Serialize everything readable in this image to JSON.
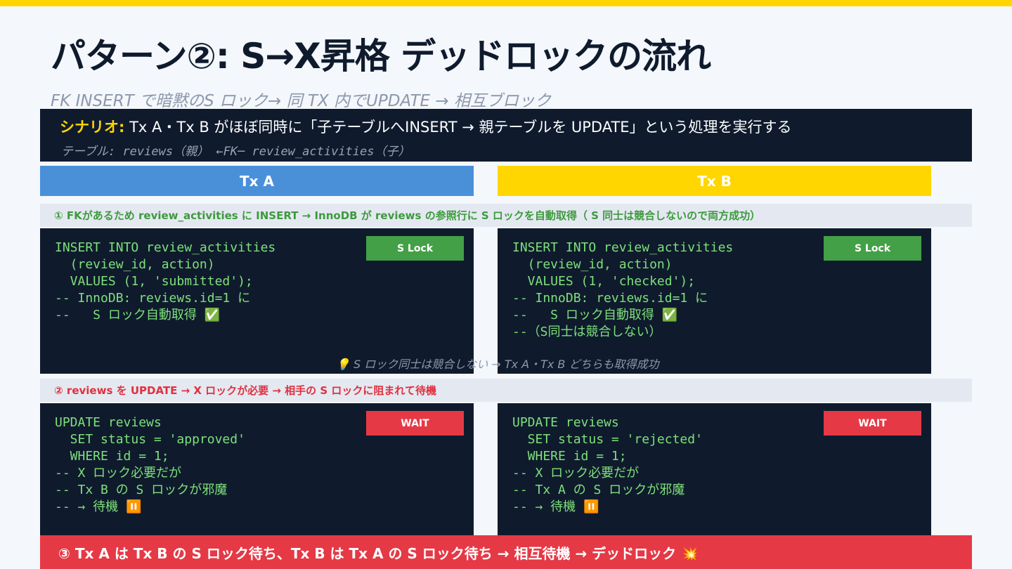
{
  "title": "パターン②: S→X昇格 デッドロックの流れ",
  "subtitle": "FK INSERT で暗黙のS ロック→ 同 TX 内でUPDATE → 相互ブロック",
  "scenario": {
    "label": "シナリオ:",
    "text": "Tx A・Tx B がほぼ同時に「子テーブルへINSERT → 親テーブルを UPDATE」という処理を実行する",
    "tables": "テーブル:  reviews（親） ←FK─  review_activities（子）"
  },
  "tx_a": {
    "label": "Tx A",
    "color": "#4a90d9"
  },
  "tx_b": {
    "label": "Tx B",
    "color": "#ffd600"
  },
  "step1": "① FKがあるため review_activities に INSERT → InnoDB が reviews の参照行に S ロックを自動取得（ S 同士は競合しないので両方成功）",
  "step2": "② reviews を UPDATE → X ロックが必要 → 相手の S ロックに阻まれて待機",
  "code": {
    "a1": "INSERT INTO review_activities\n  (review_id, action)\n  VALUES (1, 'submitted');\n-- InnoDB: reviews.id=1 に\n--   S ロック自動取得 ✅",
    "b1": "INSERT INTO review_activities\n  (review_id, action)\n  VALUES (1, 'checked');\n-- InnoDB: reviews.id=1 に\n--   S ロック自動取得 ✅\n--（S同士は競合しない）",
    "a2": "UPDATE reviews\n  SET status = 'approved'\n  WHERE id = 1;\n-- X ロック必要だが\n-- Tx B の S ロックが邪魔\n-- → 待機 ⏸️",
    "b2": "UPDATE reviews\n  SET status = 'rejected'\n  WHERE id = 1;\n-- X ロック必要だが\n-- Tx A の S ロックが邪魔\n-- → 待機 ⏸️"
  },
  "badges": {
    "slock": "S Lock",
    "wait": "WAIT"
  },
  "tip": "💡 S ロック同士は競合しない → Tx A・Tx B どちらも取得成功",
  "conclusion": "③ Tx A は Tx B の S ロック待ち、Tx B は Tx A の S ロック待ち → 相互待機 → デッドロック 💥",
  "colors": {
    "accent": "#ffd600",
    "dark": "#0f1b2d",
    "success": "#43a047",
    "danger": "#e53946"
  }
}
